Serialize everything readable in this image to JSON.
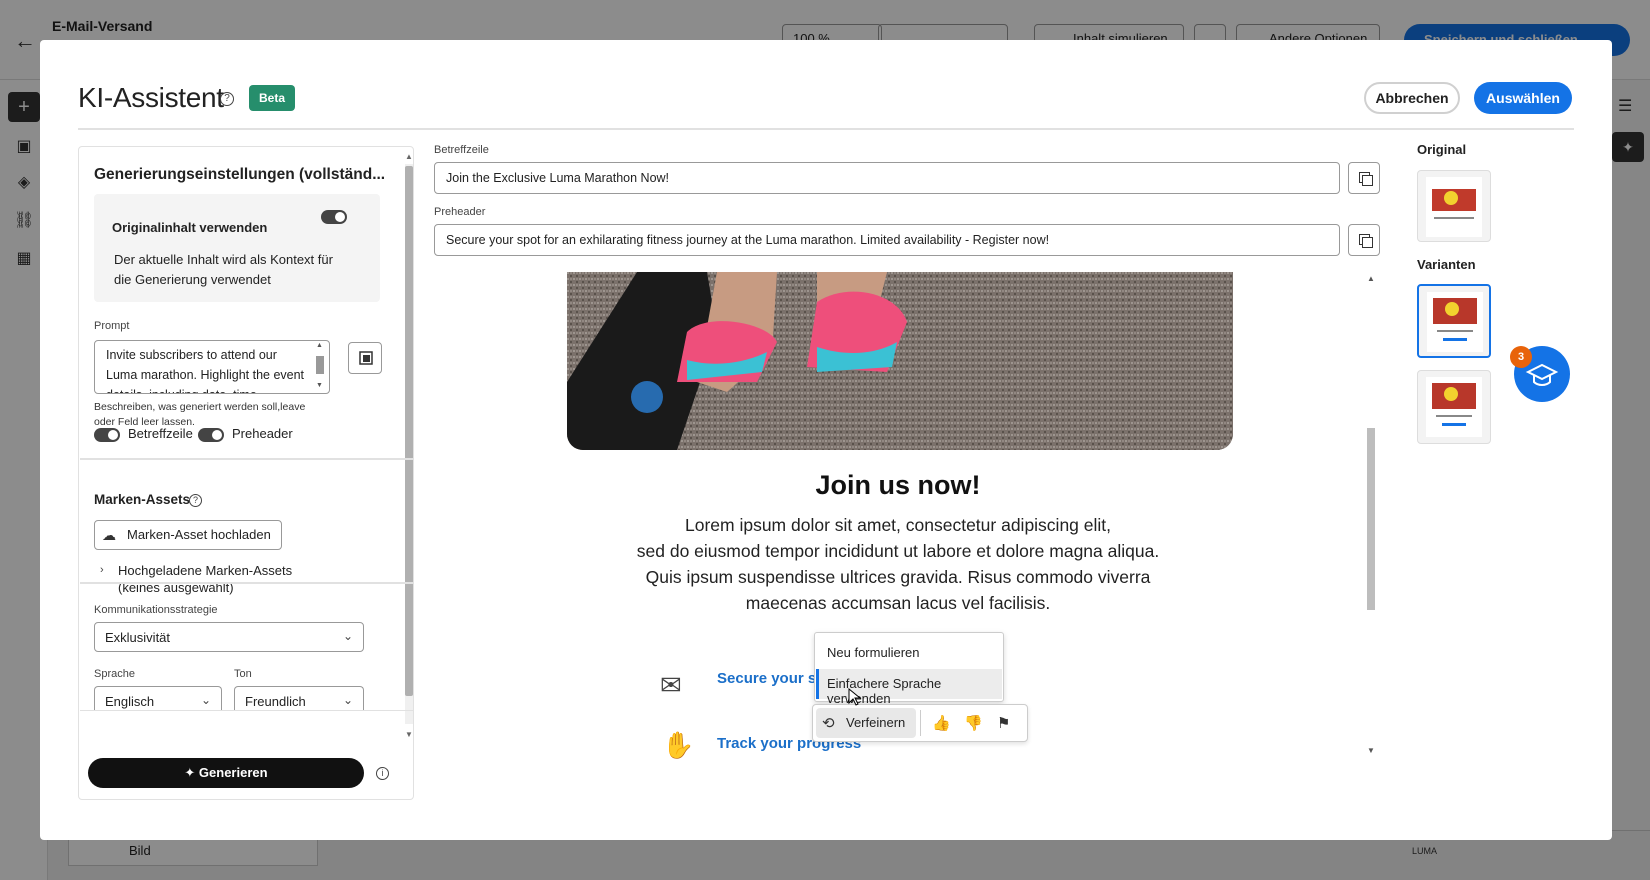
{
  "background": {
    "title": "E-Mail-Versand",
    "zoom": "100 %",
    "simulate_label": "Inhalt simulieren",
    "more_label": "Andere Optionen",
    "save_label": "Speichern und schließen",
    "bottom_item": "Bild",
    "brand": "LUMA"
  },
  "modal": {
    "title": "KI-Assistent",
    "badge": "Beta",
    "cancel_label": "Abbrechen",
    "select_label": "Auswählen"
  },
  "settings": {
    "heading": "Generierungseinstellungen  (vollständ...",
    "original_content": {
      "label": "Originalinhalt verwenden",
      "enabled": true,
      "description": "Der aktuelle Inhalt wird als Kontext für die Generierung  verwendet"
    },
    "prompt": {
      "label": "Prompt",
      "value": "Invite subscribers to attend our Luma marathon. Highlight the event details, including date, time",
      "help": "Beschreiben, was generiert werden soll,leave oder Feld leer lassen."
    },
    "toggles": [
      {
        "label": "Betreffzeile",
        "enabled": true
      },
      {
        "label": "Preheader",
        "enabled": true
      }
    ],
    "brand_assets": {
      "heading": "Marken-Assets",
      "upload_label": "Marken-Asset hochladen",
      "uploaded_line1": "Hochgeladene Marken-Assets",
      "uploaded_line2": "(keines ausgewählt)"
    },
    "strategy": {
      "label": "Kommunikationsstrategie",
      "value": "Exklusivität"
    },
    "language": {
      "label": "Sprache",
      "value": "Englisch"
    },
    "tone": {
      "label": "Ton",
      "value": "Freundlich"
    },
    "generate_label": "Generieren"
  },
  "content": {
    "subject": {
      "label": "Betreffzeile",
      "value": "Join the Exclusive Luma Marathon Now!"
    },
    "preheader": {
      "label": "Preheader",
      "value": "Secure your spot for an exhilarating fitness journey at the Luma marathon. Limited availability - Register now!"
    },
    "email": {
      "heading": "Join us now!",
      "body": [
        "Lorem ipsum dolor sit amet, consectetur adipiscing elit,",
        "sed do eiusmod tempor incididunt ut labore et dolore magna aliqua.",
        "Quis ipsum suspendisse ultrices gravida. Risus commodo viverra",
        "maecenas accumsan lacus vel facilisis."
      ],
      "feature1": "Secure your s",
      "feature2": "Track your progress"
    }
  },
  "refine": {
    "options": [
      "Neu formulieren",
      "Einfachere Sprache verwenden"
    ],
    "highlighted": "Einfachere Sprache verwenden",
    "button_label": "Verfeinern"
  },
  "right": {
    "original_label": "Original",
    "variants_label": "Varianten",
    "learn_count": "3"
  },
  "colors": {
    "accent": "#1473e6",
    "beta": "#268e6c",
    "link": "#1b6fc9"
  }
}
